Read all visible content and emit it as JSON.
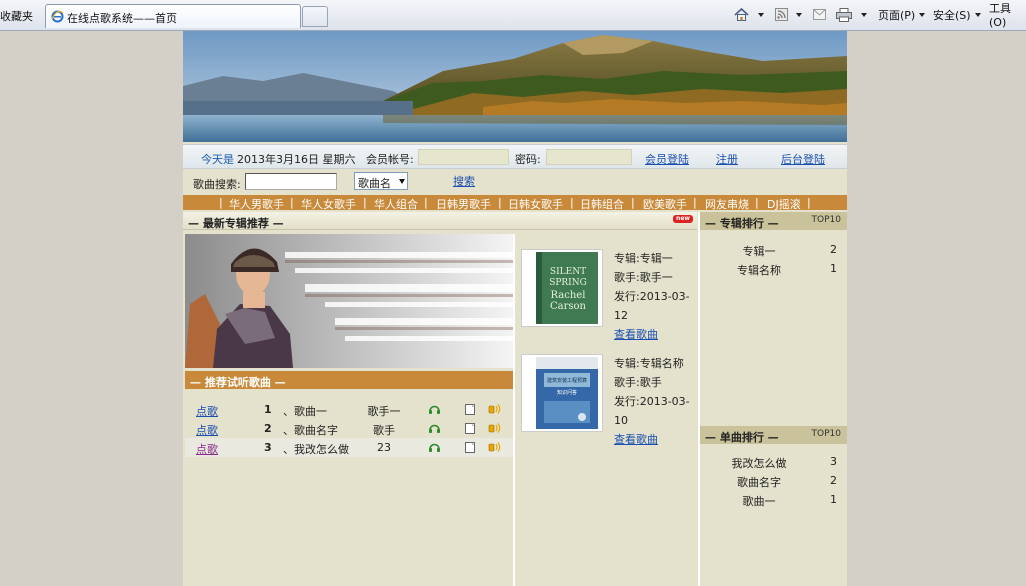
{
  "browser": {
    "favorites_label": "收藏夹",
    "tab_title": "在线点歌系统——首页",
    "page_menu": "页面(P)",
    "safety_menu": "安全(S)",
    "tools_menu": "工具(O)"
  },
  "info_bar": {
    "today_prefix": "今天是",
    "date": "2013年3月16日 星期六",
    "account_label": "会员帐号:",
    "password_label": "密码:",
    "member_login": "会员登陆",
    "register": "注册",
    "admin_login": "后台登陆"
  },
  "search": {
    "label": "歌曲搜索:",
    "input_value": "",
    "select_value": "歌曲名",
    "button": "搜索"
  },
  "nav": {
    "items": [
      "华人男歌手",
      "华人女歌手",
      "华人组合",
      "日韩男歌手",
      "日韩女歌手",
      "日韩组合",
      "欧美歌手",
      "网友串烧",
      "DJ摇滚"
    ]
  },
  "latest_albums": {
    "title": "最新专辑推荐",
    "badge": "new",
    "albums": [
      {
        "album_label": "专辑:",
        "album": "专辑一",
        "artist_label": "歌手:",
        "artist": "歌手一",
        "release_label": "发行:",
        "release": "2013-03-12",
        "link": "查看歌曲",
        "cover_lines": [
          "SILENT",
          "SPRING",
          "Rachel",
          "Carson"
        ]
      },
      {
        "album_label": "专辑:",
        "album": "专辑名称",
        "artist_label": "歌手:",
        "artist": "歌手",
        "release_label": "发行:",
        "release": "2013-03-10",
        "link": "查看歌曲",
        "cover_lines": [
          "建筑安装工程预算",
          "知识问答"
        ]
      }
    ]
  },
  "recommended": {
    "title": "推荐试听歌曲",
    "rows": [
      {
        "order": "点歌",
        "num": "1",
        "name": "、歌曲一",
        "artist": "歌手一"
      },
      {
        "order": "点歌",
        "num": "2",
        "name": "、歌曲名字",
        "artist": "歌手"
      },
      {
        "order": "点歌",
        "num": "3",
        "name": "、我改怎么做",
        "artist": "23"
      }
    ]
  },
  "album_rank": {
    "title": "专辑排行",
    "badge": "TOP10",
    "rows": [
      {
        "name": "专辑一",
        "count": "2"
      },
      {
        "name": "专辑名称",
        "count": "1"
      }
    ]
  },
  "single_rank": {
    "title": "单曲排行",
    "badge": "TOP10",
    "rows": [
      {
        "name": "我改怎么做",
        "count": "3"
      },
      {
        "name": "歌曲名字",
        "count": "2"
      },
      {
        "name": "歌曲一",
        "count": "1"
      }
    ]
  },
  "colors": {
    "accent_orange": "#c88a3a",
    "page_bg": "#e4e2cc",
    "rank_header": "#c9c29a",
    "link_blue": "#1a4fb0"
  }
}
